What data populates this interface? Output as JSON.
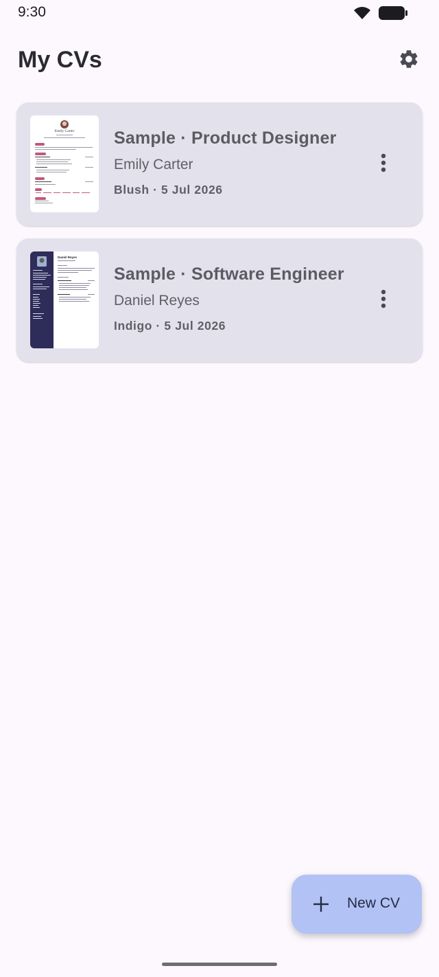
{
  "status_bar": {
    "time": "9:30",
    "icons": [
      "wifi-icon",
      "battery-icon"
    ]
  },
  "app_bar": {
    "title": "My CVs",
    "settings_icon": "gear-icon"
  },
  "cvs": [
    {
      "title": "Sample · Product Designer",
      "name": "Emily Carter",
      "meta": "Blush · 5 Jul 2026",
      "thumbnail_name": "Emily Carter",
      "thumbnail_accent": "#C2587A"
    },
    {
      "title": "Sample · Software Engineer",
      "name": "Daniel Reyes",
      "meta": "Indigo · 5 Jul 2026",
      "thumbnail_name": "Daniel Reyes",
      "thumbnail_accent": "#2E2C58"
    }
  ],
  "fab": {
    "label": "New CV",
    "icon": "plus-icon"
  },
  "colors": {
    "background": "#FCF8FE",
    "card": "#E3E2EC",
    "fab": "#B2C2F4",
    "blush": "#C2587A",
    "indigo": "#2E2C58"
  }
}
